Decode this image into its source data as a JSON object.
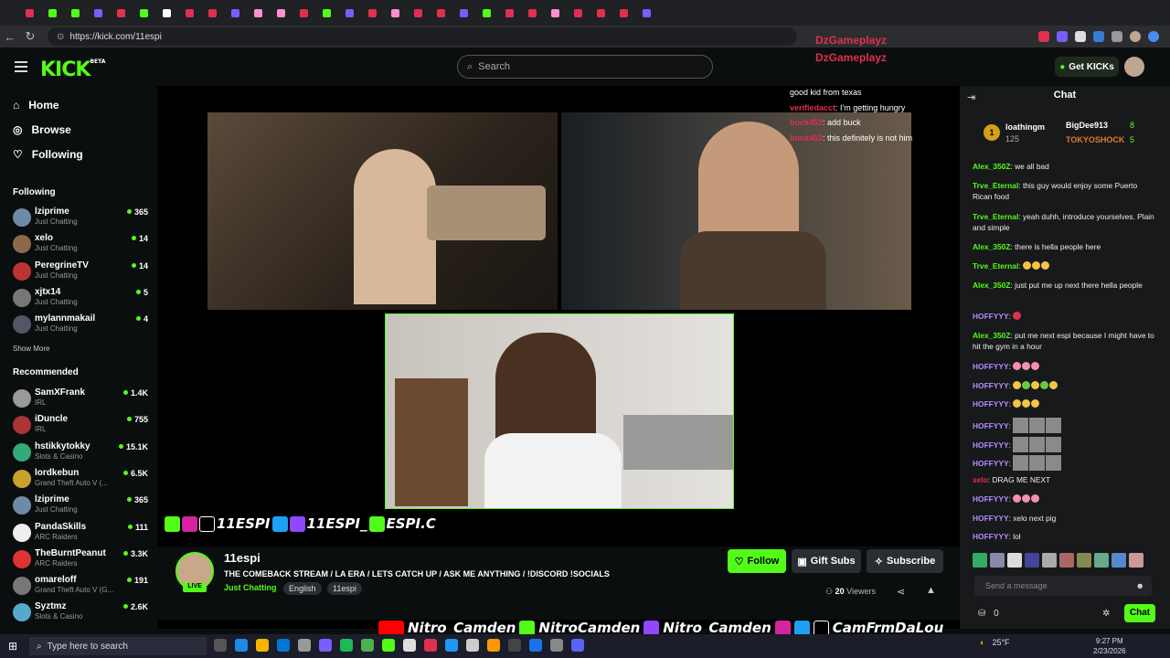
{
  "browser": {
    "url": "https://kick.com/11espi",
    "tab_colors": [
      "#e0304d",
      "#53fc18",
      "#53fc18",
      "#7b5cff",
      "#e0304d",
      "#53fc18",
      "#ffffff",
      "#e0304d",
      "#e0304d",
      "#7b5cff",
      "#ff8fd0",
      "#ff8fd0",
      "#e0304d",
      "#53fc18",
      "#7b5cff",
      "#e0304d",
      "#ff8fd0",
      "#e0304d",
      "#e0304d",
      "#7b5cff",
      "#53fc18",
      "#e0304d",
      "#e0304d",
      "#ff8fd0",
      "#e0304d",
      "#e0304d",
      "#e0304d",
      "#7b5cff"
    ]
  },
  "header": {
    "logo": "KICK",
    "logo_badge": "BETA",
    "search_placeholder": "Search",
    "get_kicks": "Get KICKs"
  },
  "overlay_names": [
    "DzGameplayz",
    "DzGameplayz"
  ],
  "overlay_chat": [
    {
      "user": "",
      "text": "good kid from texas"
    },
    {
      "user": "verifiedacct",
      "text": "I'm getting hungry"
    },
    {
      "user": "buck453",
      "text": "add buck"
    },
    {
      "user": "buck453",
      "text": "this definitely is not him"
    }
  ],
  "sidebar": {
    "nav": [
      {
        "label": "Home",
        "icon": "home-icon"
      },
      {
        "label": "Browse",
        "icon": "compass-icon"
      },
      {
        "label": "Following",
        "icon": "heart-icon"
      }
    ],
    "following_title": "Following",
    "following": [
      {
        "name": "lziprime",
        "category": "Just Chatting",
        "viewers": "365",
        "color": "#6f8aa8"
      },
      {
        "name": "xelo",
        "category": "Just Chatting",
        "viewers": "14",
        "color": "#8a6a4a"
      },
      {
        "name": "PeregrineTV",
        "category": "Just Chatting",
        "viewers": "14",
        "color": "#b33"
      },
      {
        "name": "xjtx14",
        "category": "Just Chatting",
        "viewers": "5",
        "color": "#777"
      },
      {
        "name": "mylannmakail",
        "category": "Just Chatting",
        "viewers": "4",
        "color": "#556"
      }
    ],
    "show_more": "Show More",
    "recommended_title": "Recommended",
    "recommended": [
      {
        "name": "SamXFrank",
        "category": "IRL",
        "viewers": "1.4K",
        "color": "#999"
      },
      {
        "name": "iDuncle",
        "category": "IRL",
        "viewers": "755",
        "color": "#a33"
      },
      {
        "name": "hstikkytokky",
        "category": "Slots & Casino",
        "viewers": "15.1K",
        "color": "#3a7"
      },
      {
        "name": "lordkebun",
        "category": "Grand Theft Auto V (...",
        "viewers": "6.5K",
        "color": "#c9a227"
      },
      {
        "name": "lziprime",
        "category": "Just Chatting",
        "viewers": "365",
        "color": "#6f8aa8"
      },
      {
        "name": "PandaSkills",
        "category": "ARC Raiders",
        "viewers": "111",
        "color": "#eee"
      },
      {
        "name": "TheBurntPeanut",
        "category": "ARC Raiders",
        "viewers": "3.3K",
        "color": "#d33"
      },
      {
        "name": "omareloff",
        "category": "Grand Theft Auto V (G...",
        "viewers": "191",
        "color": "#777"
      },
      {
        "name": "Syztmz",
        "category": "Slots & Casino",
        "viewers": "2.6K",
        "color": "#5ac"
      }
    ]
  },
  "socials_text": [
    "11ESPI",
    "11ESPI_",
    "ESPI.C"
  ],
  "stream": {
    "name": "11espi",
    "live": "LIVE",
    "title": "THE COMEBACK STREAM / LA ERA / LETS CATCH UP / ASK ME ANYTHING / !DISCORD !SOCIALS",
    "category": "Just Chatting",
    "tags": [
      "English",
      "11espi"
    ],
    "follow": "Follow",
    "gift_subs": "Gift Subs",
    "subscribe": "Subscribe",
    "viewer_count": "20",
    "viewers_label": "Viewers"
  },
  "chat": {
    "title": "Chat",
    "pinned": {
      "rank": "1",
      "user": "loathingm",
      "amount": "125",
      "top": [
        {
          "name": "BigDee913",
          "count": "8"
        },
        {
          "name": "TOKYOSHOCK",
          "count": "5"
        }
      ]
    },
    "messages": [
      {
        "user": "Alex_350Z",
        "color": "#53fc18",
        "text": "we all bad"
      },
      {
        "user": "Trve_Eternal",
        "color": "#53fc18",
        "text": "this guy would enjoy some Puerto Rican food"
      },
      {
        "user": "Trve_Eternal",
        "color": "#53fc18",
        "text": "yeah duhh, introduce yourselves. Plain and simple"
      },
      {
        "user": "Alex_350Z",
        "color": "#53fc18",
        "text": "there is hella people here"
      },
      {
        "user": "Trve_Eternal",
        "color": "#53fc18",
        "text": ""
      },
      {
        "user": "Alex_350Z",
        "color": "#53fc18",
        "text": "just put me up next there hella people"
      },
      {
        "user": "HOFFYYY",
        "color": "#b48cff",
        "text": ""
      },
      {
        "user": "Alex_350Z",
        "color": "#53fc18",
        "text": "put me next espi because I might have to hit the gym in a hour"
      },
      {
        "user": "HOFFYYY",
        "color": "#b48cff",
        "text": ""
      },
      {
        "user": "HOFFYYY",
        "color": "#b48cff",
        "text": ""
      },
      {
        "user": "HOFFYYY",
        "color": "#b48cff",
        "text": ""
      },
      {
        "user": "HOFFYYY",
        "color": "#b48cff",
        "text": ""
      },
      {
        "user": "HOFFYYY",
        "color": "#b48cff",
        "text": ""
      },
      {
        "user": "HOFFYYY",
        "color": "#b48cff",
        "text": ""
      },
      {
        "user": "xelo",
        "color": "#e0304d",
        "text": "DRAG ME NEXT"
      },
      {
        "user": "HOFFYYY",
        "color": "#b48cff",
        "text": ""
      },
      {
        "user": "HOFFYYY",
        "color": "#b48cff",
        "text": "xelo next pig"
      },
      {
        "user": "HOFFYYY",
        "color": "#b48cff",
        "text": "lol"
      }
    ],
    "send_placeholder": "Send a message",
    "points": "0",
    "send_button": "Chat"
  },
  "bottom_banner": [
    "Nitro_Camden",
    "NitroCamden",
    "Nitro_Camden",
    "CamFrmDaLou"
  ],
  "taskbar": {
    "search": "Type here to search",
    "weather": "25°F",
    "time": "9:27 PM",
    "date": "2/23/2026"
  }
}
